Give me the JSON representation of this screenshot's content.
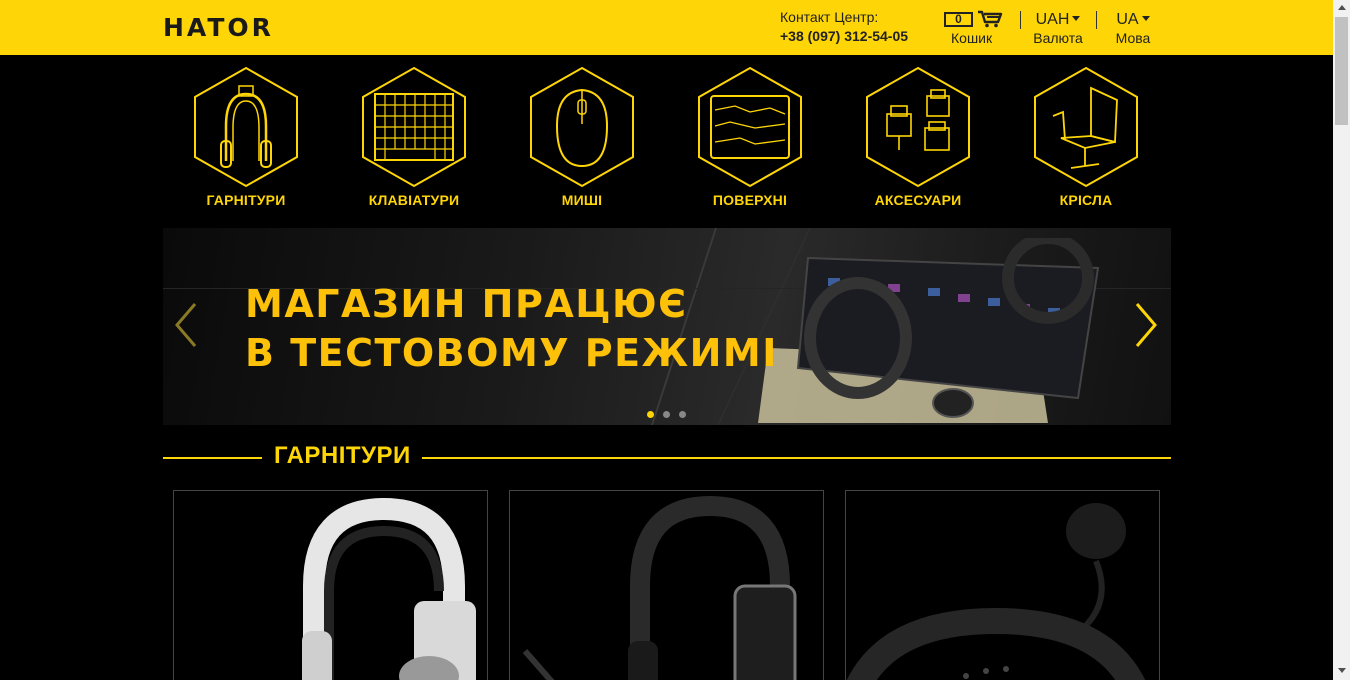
{
  "header": {
    "logo_text": "HATOR",
    "contact_label": "Контакт Центр:",
    "contact_phone": "+38 (097) 312-54-05",
    "cart_count": "0",
    "cart_label": "Кошик",
    "currency_value": "UAH",
    "currency_label": "Валюта",
    "language_value": "UA",
    "language_label": "Мова"
  },
  "categories": [
    {
      "label": "ГАРНІТУРИ",
      "icon": "headset-icon"
    },
    {
      "label": "КЛАВІАТУРИ",
      "icon": "keyboard-icon"
    },
    {
      "label": "МИШІ",
      "icon": "mouse-icon"
    },
    {
      "label": "ПОВЕРХНІ",
      "icon": "mousepad-icon"
    },
    {
      "label": "АКСЕСУАРИ",
      "icon": "accessories-icon"
    },
    {
      "label": "КРІСЛА",
      "icon": "chair-icon"
    }
  ],
  "banner": {
    "line1": "МАГАЗИН ПРАЦЮЄ",
    "line2": "В ТЕСТОВОМУ РЕЖИМІ",
    "slides_total": 3,
    "active_slide": 1
  },
  "section": {
    "title": "ГАРНІТУРИ"
  },
  "colors": {
    "accent": "#fed506",
    "background": "#000000",
    "header_text": "#222222"
  }
}
